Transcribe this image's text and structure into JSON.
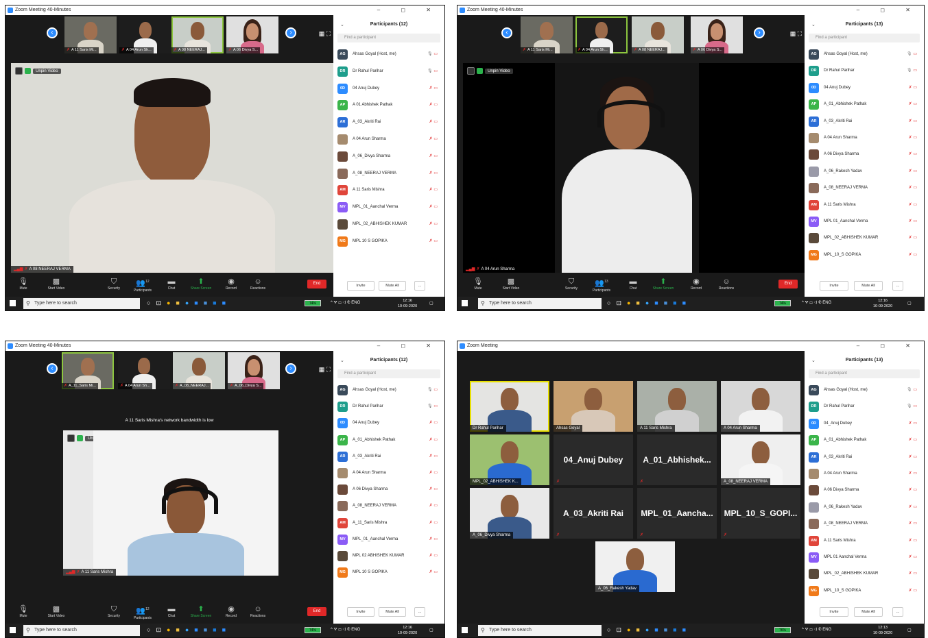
{
  "colors": {
    "zoom_blue": "#2d8cff",
    "end_red": "#e02828",
    "share_green": "#2bb24c",
    "active_speaker": "#8dc63f",
    "gallery_active": "#e8e000"
  },
  "toolbar": {
    "mute": "Mute",
    "start_video": "Start Video",
    "security": "Security",
    "participants": "Participants",
    "chat": "Chat",
    "share": "Share Screen",
    "record": "Record",
    "reactions": "Reactions",
    "end": "End"
  },
  "participants_footer": {
    "invite": "Invite",
    "mute_all": "Mute All",
    "more": "..."
  },
  "taskbar": {
    "search_placeholder": "Type here to search",
    "lang": "ENG"
  },
  "screens": [
    {
      "window_title": "Zoom Meeting 40-Minutes",
      "participants_title": "Participants (12)",
      "find_placeholder": "Find a participant",
      "thumbs": [
        "A 11 Saris Mi...",
        "A 04 Arun Sh...",
        "A 08 NEERAJ...",
        "A 06 Divya S..."
      ],
      "unpin": "Unpin Video",
      "main_label": "A 08 NEERAJ VERMA",
      "participants_count_badge": "12",
      "battery": "74%",
      "time": "12:16",
      "date": "10-09-2020",
      "participants": [
        {
          "initials": "AG",
          "name": "Ahsas Goyal (Host, me)",
          "color": "#3a4a5a"
        },
        {
          "initials": "DR",
          "name": "Dr Rahul Parihar",
          "color": "#1e9e8c"
        },
        {
          "initials": "0D",
          "name": "04 Anuj Dubey",
          "color": "#2d8cff"
        },
        {
          "initials": "AP",
          "name": "A 01 Abhishek Pathak",
          "color": "#3bb54a"
        },
        {
          "initials": "AR",
          "name": "A_03_Akriti Rai",
          "color": "#2d6fd6"
        },
        {
          "initials": "",
          "name": "A 04 Arun Sharma",
          "color": "#a58b6e"
        },
        {
          "initials": "",
          "name": "A_06_Divya Sharma",
          "color": "#6b4a3a"
        },
        {
          "initials": "",
          "name": "A_08_NEERAJ VERMA",
          "color": "#8a6a5a"
        },
        {
          "initials": "AM",
          "name": "A 11 Saris Mishra",
          "color": "#e0453a"
        },
        {
          "initials": "MV",
          "name": "MPL_01_Aanchal Verma",
          "color": "#8b5cf6"
        },
        {
          "initials": "",
          "name": "MPL_02_ABHISHEK KUMAR",
          "color": "#5a4a3a"
        },
        {
          "initials": "MG",
          "name": "MPL 10 S GOPIKA",
          "color": "#f07a1a"
        }
      ]
    },
    {
      "window_title": "Zoom Meeting 40-Minutes",
      "participants_title": "Participants (13)",
      "find_placeholder": "Find a participant",
      "thumbs": [
        "A 11 Saris Mi...",
        "A 04 Arun Sh...",
        "A 08 NEERAJ...",
        "A 06 Divya S..."
      ],
      "unpin": "Unpin Video",
      "main_label": "A 04 Arun Sharma",
      "participants_count_badge": "13",
      "battery": "74%",
      "time": "12:16",
      "date": "10-09-2020",
      "participants": [
        {
          "initials": "AG",
          "name": "Ahsas Goyal (Host, me)",
          "color": "#3a4a5a"
        },
        {
          "initials": "DR",
          "name": "Dr Rahul Parihar",
          "color": "#1e9e8c"
        },
        {
          "initials": "0D",
          "name": "04 Anuj Dubey",
          "color": "#2d8cff"
        },
        {
          "initials": "AP",
          "name": "A_01_Abhishek Pathak",
          "color": "#3bb54a"
        },
        {
          "initials": "AR",
          "name": "A_03_Akriti Rai",
          "color": "#2d6fd6"
        },
        {
          "initials": "",
          "name": "A 04 Arun Sharma",
          "color": "#a58b6e"
        },
        {
          "initials": "",
          "name": "A 06 Divya Sharma",
          "color": "#6b4a3a"
        },
        {
          "initials": "",
          "name": "A_06_Rakesh Yadav",
          "color": "#9a9aa8"
        },
        {
          "initials": "",
          "name": "A_08_NEERAJ VERMA",
          "color": "#8a6a5a"
        },
        {
          "initials": "AM",
          "name": "A 11 Saris Mishra",
          "color": "#e0453a"
        },
        {
          "initials": "MV",
          "name": "MPL 01_Aanchal Verma",
          "color": "#8b5cf6"
        },
        {
          "initials": "",
          "name": "MPL_02_ABHISHEK KUMAR",
          "color": "#5a4a3a"
        },
        {
          "initials": "MG",
          "name": "MPL_10_S GOPIKA",
          "color": "#f07a1a"
        }
      ]
    },
    {
      "window_title": "Zoom Meeting 40-Minutes",
      "participants_title": "Participants (12)",
      "find_placeholder": "Find a participant",
      "thumbs": [
        "A_11_Saris Mi...",
        "A 04 Arun Sh...",
        "A_08_NEERAJ...",
        "A_06_Divya S..."
      ],
      "unpin": "Unpin Video",
      "banner": "A 11 Saris Mishra's network bandwidth is low",
      "main_label": "A 11 Saris Mishra",
      "participants_count_badge": "12",
      "battery": "74%",
      "time": "12:16",
      "date": "10-09-2020",
      "participants": [
        {
          "initials": "AG",
          "name": "Ahsas Goyal (Host, me)",
          "color": "#3a4a5a"
        },
        {
          "initials": "DR",
          "name": "Dr Rahul Parihar",
          "color": "#1e9e8c"
        },
        {
          "initials": "0D",
          "name": "04 Anuj Dubey",
          "color": "#2d8cff"
        },
        {
          "initials": "AP",
          "name": "A_01_Abhishek Pathak",
          "color": "#3bb54a"
        },
        {
          "initials": "AR",
          "name": "A_03_Akriti Rai",
          "color": "#2d6fd6"
        },
        {
          "initials": "",
          "name": "A 04 Arun Sharma",
          "color": "#a58b6e"
        },
        {
          "initials": "",
          "name": "A 06 Divya Sharma",
          "color": "#6b4a3a"
        },
        {
          "initials": "",
          "name": "A_08_NEERAJ VERMA",
          "color": "#8a6a5a"
        },
        {
          "initials": "AM",
          "name": "A_11_Saris Mishra",
          "color": "#e0453a"
        },
        {
          "initials": "MV",
          "name": "MPL_01_Aanchal Verma",
          "color": "#8b5cf6"
        },
        {
          "initials": "",
          "name": "MPL 02 ABHISHEK KUMAR",
          "color": "#5a4a3a"
        },
        {
          "initials": "MG",
          "name": "MPL 10 S GOPIKA",
          "color": "#f07a1a"
        }
      ]
    },
    {
      "window_title": "Zoom Meeting",
      "participants_title": "Participants (13)",
      "find_placeholder": "Find a participant",
      "battery": "76%",
      "time": "12:13",
      "date": "10-09-2020",
      "gallery": [
        {
          "label": "Dr Rahul Parihar",
          "kind": "video",
          "active": true
        },
        {
          "label": "Ahsas Goyal",
          "kind": "video"
        },
        {
          "label": "A 11 Saris Mishra",
          "kind": "video"
        },
        {
          "label": "A 04 Arun Sharma",
          "kind": "video"
        },
        {
          "label": "MPL_02_ABHISHEK K...",
          "kind": "video"
        },
        {
          "label": "04_Anuj Dubey",
          "kind": "name"
        },
        {
          "label": "A_01_Abhishek...",
          "kind": "name"
        },
        {
          "label": "A_08_NEERAJ VERMA",
          "kind": "video"
        },
        {
          "label": "A_06_Divya Sharma",
          "kind": "video"
        },
        {
          "label": "A_03_Akriti Rai",
          "kind": "name"
        },
        {
          "label": "MPL_01_Aancha...",
          "kind": "name"
        },
        {
          "label": "MPL_10_S_GOPI...",
          "kind": "name"
        },
        {
          "label": "A_06_Rakesh Yadav",
          "kind": "video"
        }
      ],
      "participants": [
        {
          "initials": "AG",
          "name": "Ahsas Goyal (Host, me)",
          "color": "#3a4a5a"
        },
        {
          "initials": "DR",
          "name": "Dr Rahul Parihar",
          "color": "#1e9e8c"
        },
        {
          "initials": "0D",
          "name": "04_Anuj Dubey",
          "color": "#2d8cff"
        },
        {
          "initials": "AP",
          "name": "A_01_Abhishek Pathak",
          "color": "#3bb54a"
        },
        {
          "initials": "AR",
          "name": "A_03_Akriti Rai",
          "color": "#2d6fd6"
        },
        {
          "initials": "",
          "name": "A 04 Arun Sharma",
          "color": "#a58b6e"
        },
        {
          "initials": "",
          "name": "A 06 Divya Sharma",
          "color": "#6b4a3a"
        },
        {
          "initials": "",
          "name": "A_06_Rakesh Yadav",
          "color": "#9a9aa8"
        },
        {
          "initials": "",
          "name": "A_08_NEERAJ VERMA",
          "color": "#8a6a5a"
        },
        {
          "initials": "AM",
          "name": "A 11 Saris Mishra",
          "color": "#e0453a"
        },
        {
          "initials": "MV",
          "name": "MPL 01 Aanchal Verma",
          "color": "#8b5cf6"
        },
        {
          "initials": "",
          "name": "MPL_02_ABHISHEK KUMAR",
          "color": "#5a4a3a"
        },
        {
          "initials": "MG",
          "name": "MPL_10_S GOPIKA",
          "color": "#f07a1a"
        }
      ]
    }
  ]
}
